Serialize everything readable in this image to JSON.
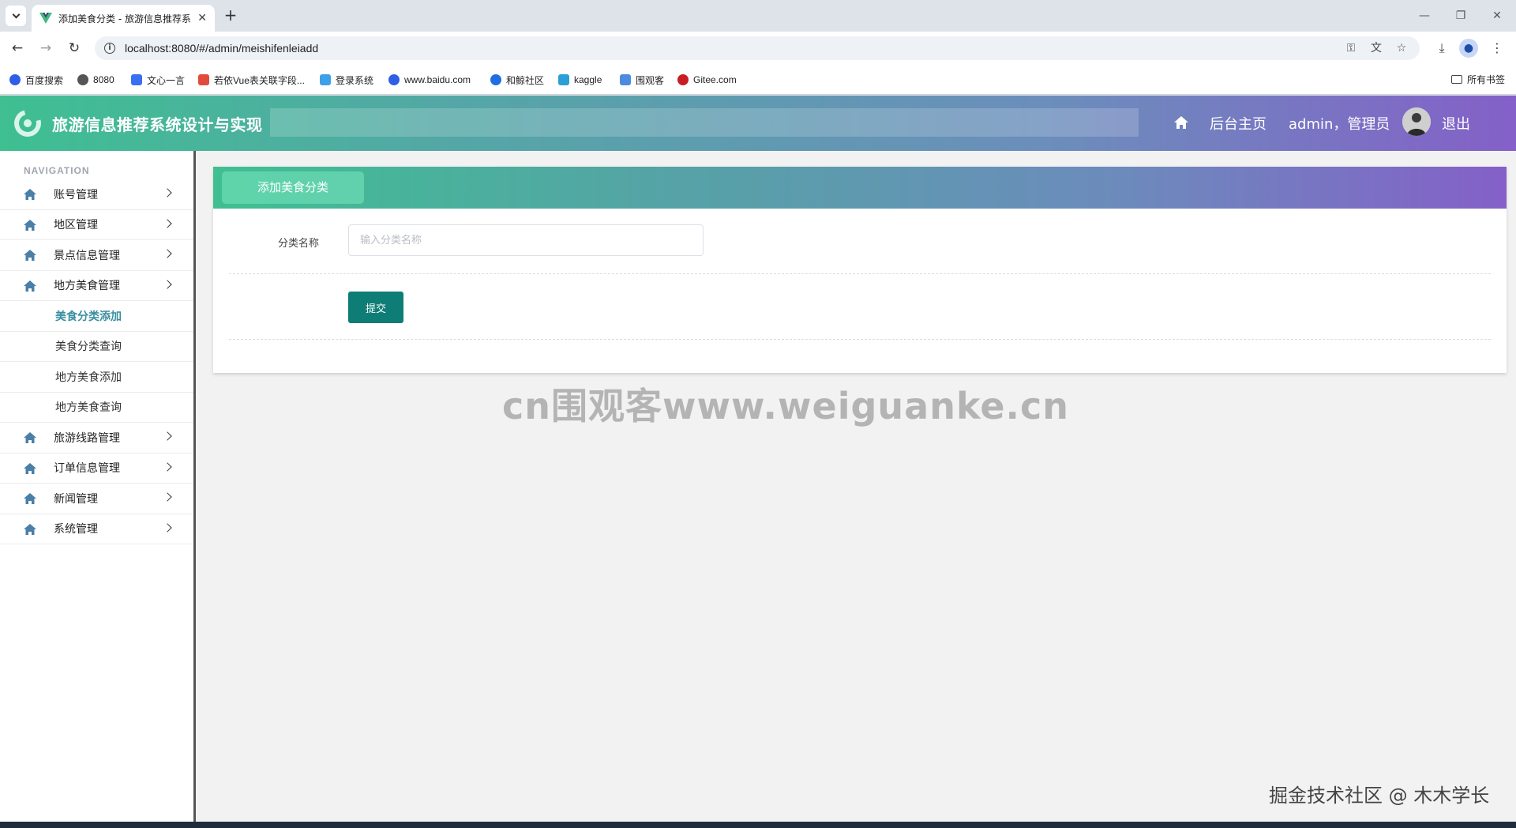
{
  "browser": {
    "tab_title": "添加美食分类 - 旅游信息推荐系",
    "url": "localhost:8080/#/admin/meishifenleiadd",
    "bookmarks": [
      {
        "label": "百度搜索",
        "color": "#2f5fe6"
      },
      {
        "label": "8080",
        "color": "#555555"
      },
      {
        "label": "文心一言",
        "color": "#3a6ff2"
      },
      {
        "label": "若依Vue表关联字段...",
        "color": "#e24b3b"
      },
      {
        "label": "登录系统",
        "color": "#3da0e8"
      },
      {
        "label": "www.baidu.com",
        "color": "#2f5fe6"
      },
      {
        "label": "和鲸社区",
        "color": "#1f6fe0"
      },
      {
        "label": "kaggle",
        "color": "#2aa0d6"
      },
      {
        "label": "围观客",
        "color": "#4c8be0"
      },
      {
        "label": "Gitee.com",
        "color": "#c71d23"
      }
    ],
    "bookmarks_folder": "所有书签"
  },
  "header": {
    "app_title": "旅游信息推荐系统设计与实现",
    "home_link": "后台主页",
    "user_label": "admin，管理员",
    "logout": "退出"
  },
  "sidebar": {
    "caption": "NAVIGATION",
    "items": [
      {
        "label": "账号管理"
      },
      {
        "label": "地区管理"
      },
      {
        "label": "景点信息管理"
      },
      {
        "label": "地方美食管理"
      }
    ],
    "sub_items": [
      {
        "label": "美食分类添加"
      },
      {
        "label": "美食分类查询"
      },
      {
        "label": "地方美食添加"
      },
      {
        "label": "地方美食查询"
      }
    ],
    "items_after": [
      {
        "label": "旅游线路管理"
      },
      {
        "label": "订单信息管理"
      },
      {
        "label": "新闻管理"
      },
      {
        "label": "系统管理"
      }
    ]
  },
  "content": {
    "panel_title": "添加美食分类",
    "field_label": "分类名称",
    "field_placeholder": "输入分类名称",
    "field_value": "",
    "submit_label": "提交"
  },
  "overlay": {
    "watermark": "cn围观客www.weiguanke.cn",
    "credit": "掘金技术社区 @ 木木学长"
  },
  "colors": {
    "accent": "#0e7d75",
    "active_menu": "#3a8ea0",
    "header_start": "#3fbf92",
    "header_end": "#8460c8"
  }
}
